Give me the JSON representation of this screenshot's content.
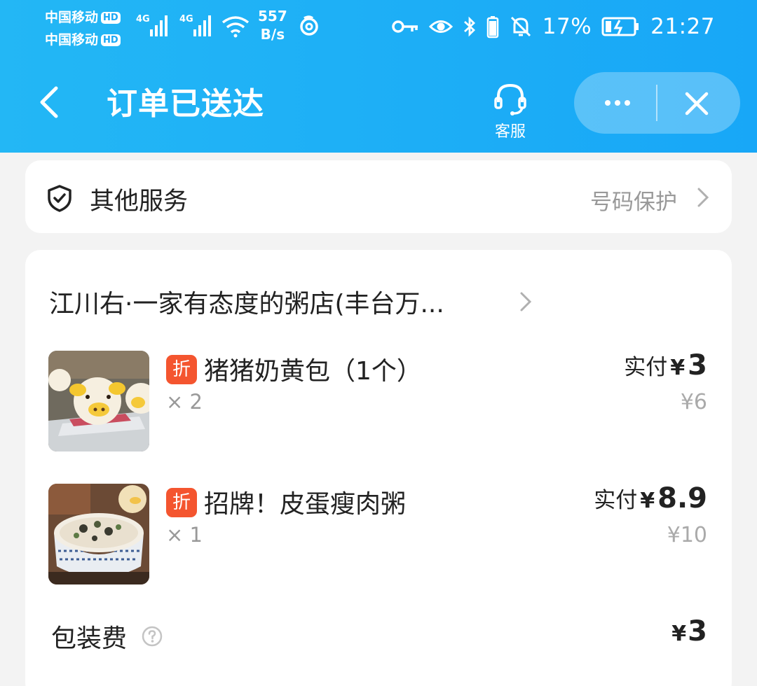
{
  "status_bar": {
    "carrier_1": "中国移动",
    "carrier_2": "中国移动",
    "hd_badge": "HD",
    "network_1": "4G",
    "network_2": "4G",
    "speed_value": "557",
    "speed_unit": "B/s",
    "battery_percent": "17%",
    "time": "21:27",
    "icons": [
      "signal-icon",
      "wifi-icon",
      "netease-icon",
      "key-icon",
      "eye-icon",
      "bluetooth-icon",
      "battery-icon",
      "mute-bell-icon",
      "charging-icon"
    ]
  },
  "header": {
    "title": "订单已送达",
    "service_label": "客服"
  },
  "service_card": {
    "title": "其他服务",
    "value": "号码保护"
  },
  "order": {
    "shop_name": "江川右·一家有态度的粥店(丰台万...",
    "items": [
      {
        "badge": "折",
        "name": "猪猪奶黄包（1个）",
        "qty": "× 2",
        "paid_label": "实付",
        "currency": "¥",
        "paid_amount": "3",
        "original_price": "¥6"
      },
      {
        "badge": "折",
        "name": "招牌！皮蛋瘦肉粥",
        "qty": "× 1",
        "paid_label": "实付",
        "currency": "¥",
        "paid_amount": "8.9",
        "original_price": "¥10"
      }
    ],
    "packaging": {
      "label": "包装费",
      "currency": "¥",
      "amount": "3"
    }
  },
  "colors": {
    "header_blue": "#1aa8f5",
    "discount_red": "#f4552f",
    "muted_gray": "#999999"
  }
}
